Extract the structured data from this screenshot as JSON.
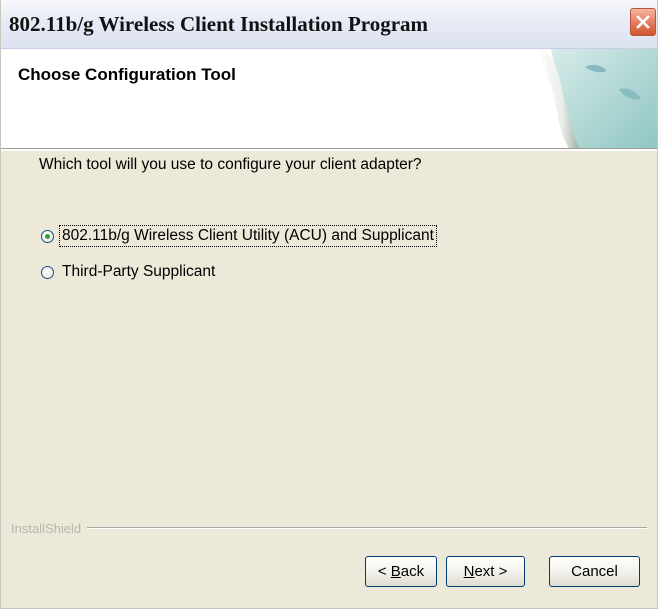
{
  "window": {
    "title": "802.11b/g Wireless Client Installation Program",
    "close_icon": "close-x-icon"
  },
  "header": {
    "title": "Choose Configuration Tool",
    "art_icon": "wizard-page-curl-graphic"
  },
  "body": {
    "question": "Which tool will you use to configure your client adapter?",
    "options": [
      {
        "label": "802.11b/g Wireless Client Utility (ACU) and Supplicant",
        "selected": true
      },
      {
        "label": "Third-Party Supplicant",
        "selected": false
      }
    ]
  },
  "footer": {
    "brand": "InstallShield",
    "buttons": {
      "back": {
        "mnemonic": "B",
        "rest": "ack",
        "prefix": "< "
      },
      "next": {
        "mnemonic": "N",
        "rest": "ext",
        "suffix": " >"
      },
      "cancel": {
        "label": "Cancel"
      }
    }
  }
}
